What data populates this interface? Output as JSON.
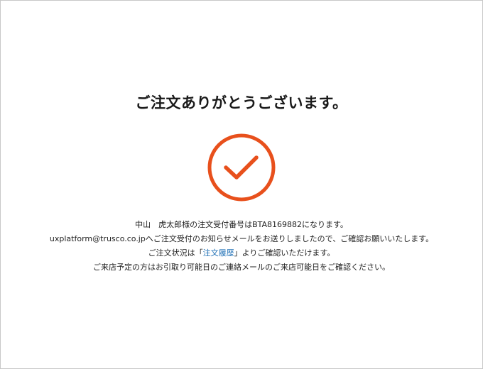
{
  "confirmation": {
    "title": "ご注文ありがとうございます。",
    "icon": "check-circle-icon",
    "accent_color": "#e8501c"
  },
  "messages": {
    "line1": "中山　虎太郎様の注文受付番号はBTA8169882になります。",
    "line2": "uxplatform@trusco.co.jpへご注文受付のお知らせメールをお送りしましたので、ご確認お願いいたします。",
    "line3_prefix": "ご注文状況は「",
    "line3_link": "注文履歴",
    "line3_suffix": "」よりご確認いただけます。",
    "line4": "ご来店予定の方はお引取り可能日のご連絡メールのご来店可能日をご確認ください。"
  }
}
